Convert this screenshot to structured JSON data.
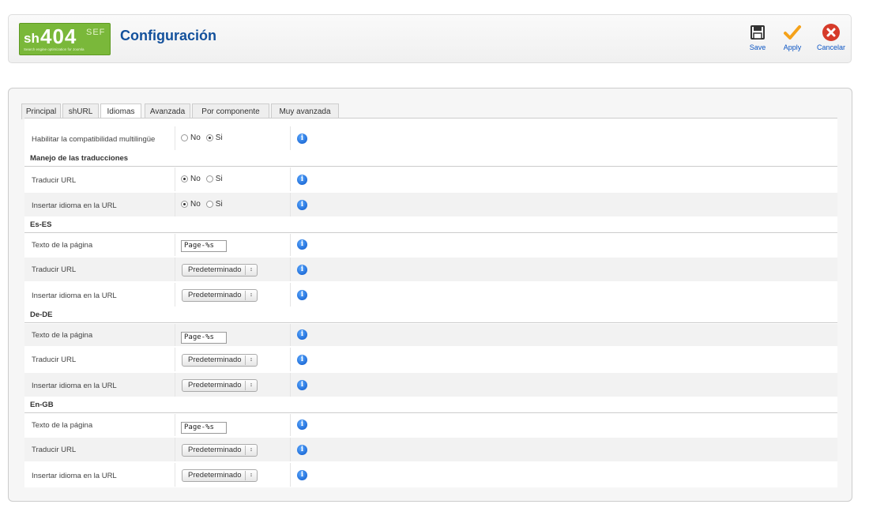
{
  "header": {
    "logo": {
      "sh": "sh",
      "n404": "404",
      "sef": "SEF",
      "tagline": "Search engine optimization for Joomla"
    },
    "title": "Configuración",
    "buttons": [
      {
        "label": "Save",
        "icon": "save-icon"
      },
      {
        "label": "Apply",
        "icon": "checkmark-icon"
      },
      {
        "label": "Cancelar",
        "icon": "cancel-icon"
      }
    ]
  },
  "tabs": [
    "Principal",
    "shURL",
    "Idiomas",
    "Avanzada",
    "Por componente",
    "Muy avanzada"
  ],
  "active_tab": "Idiomas",
  "radio_labels": {
    "no": "No",
    "si": "Si"
  },
  "rows": {
    "multilingual": {
      "label": "Habilitar la compatibilidad multilingüe",
      "value": "Si"
    },
    "sec_translations": "Manejo de las traducciones",
    "translate_url": {
      "label": "Traducir URL",
      "value": "No"
    },
    "insert_lang": {
      "label": "Insertar idioma en la URL",
      "value": "No"
    },
    "es": {
      "title": "Es-ES",
      "page_text_label": "Texto de la página",
      "page_text": "Page-%s",
      "translate_label": "Traducir URL",
      "translate": "Predeterminado",
      "insert_label": "Insertar idioma en la URL",
      "insert": "Predeterminado"
    },
    "de": {
      "title": "De-DE",
      "page_text_label": "Texto de la página",
      "page_text": "Page-%s",
      "translate_label": "Traducir URL",
      "translate": "Predeterminado",
      "insert_label": "Insertar idioma en la URL",
      "insert": "Predeterminado"
    },
    "en": {
      "title": "En-GB",
      "page_text_label": "Texto de la página",
      "page_text": "Page-%s",
      "translate_label": "Traducir URL",
      "translate": "Predeterminado",
      "insert_label": "Insertar idioma en la URL",
      "insert": "Predeterminado"
    }
  },
  "colors": {
    "title": "#13519c",
    "logo": "#7ab83a",
    "apply": "#f5a21a",
    "cancel": "#d63b2a",
    "info": "#0a56c8"
  }
}
